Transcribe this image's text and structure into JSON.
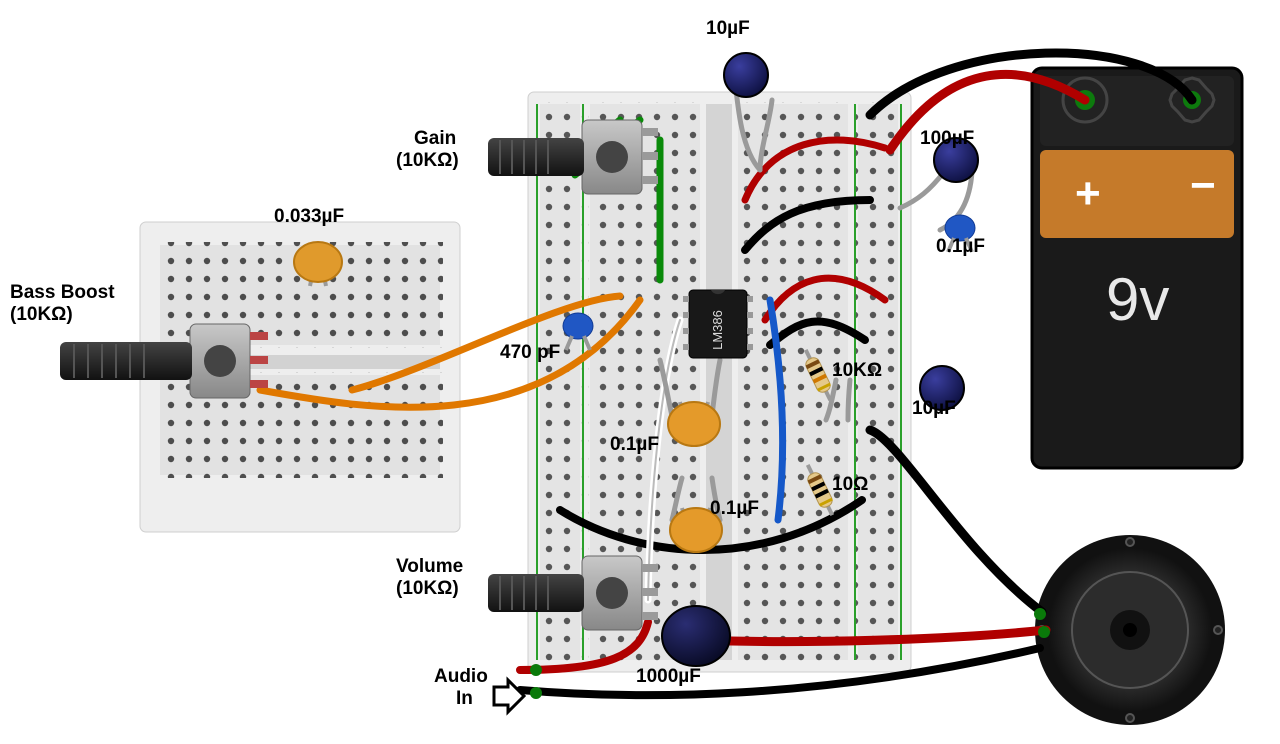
{
  "labels": {
    "c10a": "10µF",
    "gain1": "Gain",
    "gain2": "(10KΩ)",
    "c100": "100µF",
    "c0_1a": "0.1µF",
    "c0_033": "0.033µF",
    "bb1": "Bass Boost",
    "bb2": "(10KΩ)",
    "c470": "470 pF",
    "r10k": "10KΩ",
    "c10b": "10µF",
    "c0_1b": "0.1µF",
    "r10": "10Ω",
    "c0_1c": "0.1µF",
    "vol1": "Volume",
    "vol2": "(10KΩ)",
    "c1000": "1000µF",
    "ain1": "Audio",
    "ain2": "In",
    "ic": "LM386",
    "batt_plus": "+",
    "batt_minus": "-",
    "batt_v": "9v"
  }
}
